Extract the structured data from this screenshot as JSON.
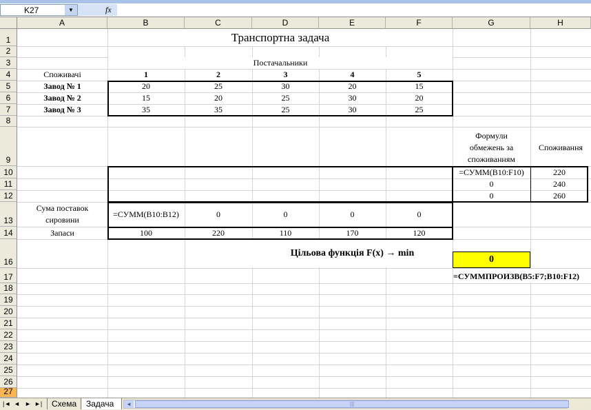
{
  "name_box": "K27",
  "fx_symbol": "fx",
  "formula_content": "",
  "columns": [
    "A",
    "B",
    "C",
    "D",
    "E",
    "F",
    "G",
    "H"
  ],
  "rows": [
    "1",
    "2",
    "3",
    "4",
    "5",
    "6",
    "7",
    "8",
    "9",
    "10",
    "11",
    "12",
    "13",
    "14",
    "16",
    "17",
    "18",
    "19",
    "20",
    "21",
    "22",
    "23",
    "24",
    "25",
    "26",
    "27"
  ],
  "sheet": {
    "title": "Транспортна задача",
    "suppliers_label": "Постачальники",
    "consumers_label": "Споживачі",
    "supplier_numbers": [
      "1",
      "2",
      "3",
      "4",
      "5"
    ],
    "plants": [
      {
        "name": "Завод № 1",
        "costs": [
          "20",
          "25",
          "30",
          "20",
          "15"
        ]
      },
      {
        "name": "Завод № 2",
        "costs": [
          "15",
          "20",
          "25",
          "30",
          "20"
        ]
      },
      {
        "name": "Завод № 3",
        "costs": [
          "35",
          "35",
          "25",
          "30",
          "25"
        ]
      }
    ],
    "g9_header": [
      "Формули",
      "обмежень за",
      "споживанням"
    ],
    "h9_header": "Споживання",
    "constraint_formulas": [
      "=СУММ(B10:F10)",
      "0",
      "0"
    ],
    "consumption": [
      "220",
      "240",
      "260"
    ],
    "supply_sum_label": [
      "Сума поставок",
      "сировини"
    ],
    "supply_sum_values": [
      "=СУММ(B10:B12)",
      "0",
      "0",
      "0",
      "0"
    ],
    "stocks_label": "Запаси",
    "stocks": [
      "100",
      "220",
      "110",
      "170",
      "120"
    ],
    "objective_label": "Цільова функція  F(x) →  min",
    "objective_value": "0",
    "objective_formula": "=СУММПРОИЗВ(B5:F7;B10:F12)"
  },
  "tabs": [
    "Схема",
    "Задача т"
  ],
  "nav_buttons": [
    "|◄",
    "◄",
    "►",
    "►|"
  ],
  "scroll_grip": "|||",
  "colors": {
    "objective_fill": "#ffff00",
    "selected_row_header": "#f9b54f",
    "header_bg": "#ebeadb"
  }
}
